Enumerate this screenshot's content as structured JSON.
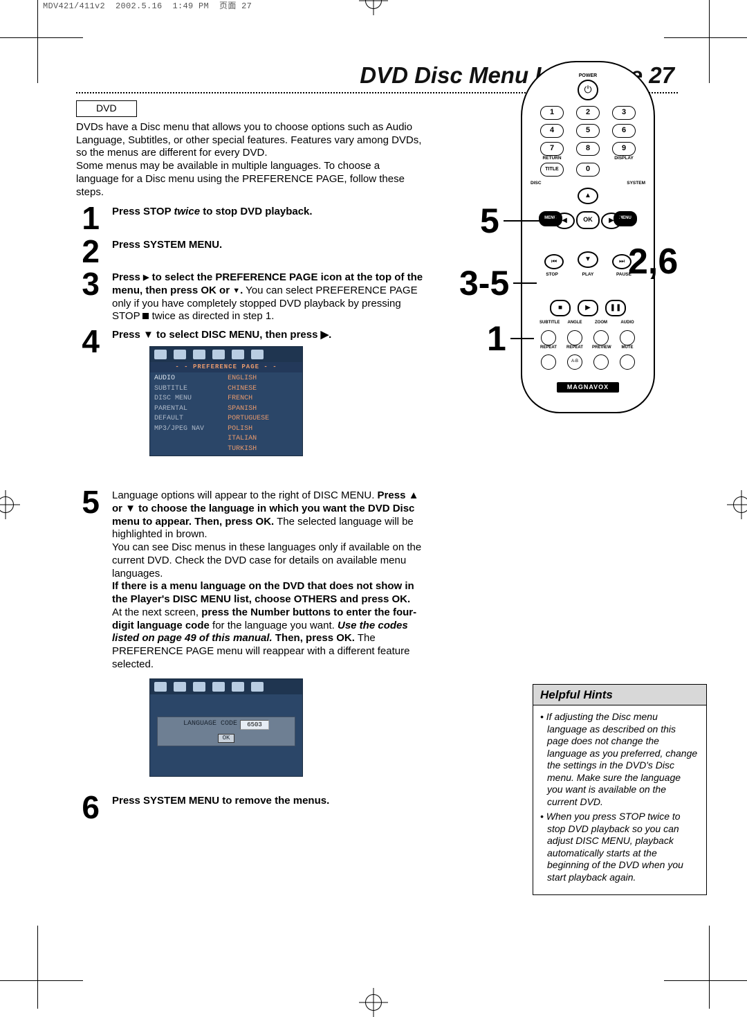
{
  "slug": "MDV421/411v2  2002.5.16  1:49 PM  页面 27",
  "title": "DVD Disc Menu Language  27",
  "dvd_box": "DVD",
  "intro_p1": "DVDs have a Disc menu that allows you to choose options such as Audio Language, Subtitles, or other special features. Features vary among DVDs, so the menus are different for every DVD.",
  "intro_p2": "Some menus may be available in multiple languages. To choose a language for a Disc menu using the PREFERENCE PAGE, follow these steps.",
  "steps": {
    "s1_bold": "Press STOP ",
    "s1_ital": "twice",
    "s1_rest": " to stop DVD playback.",
    "s2": "Press SYSTEM MENU.",
    "s3_b1": "Press ",
    "s3_b2": " to select the PREFERENCE PAGE icon at the top of the menu, then press OK or ",
    "s3_rest": " You can select PREFERENCE PAGE only if you have completely stopped DVD playback by pressing STOP ",
    "s3_end": " twice as directed in step 1.",
    "s4": "Press ▼ to select DISC MENU, then press ▶.",
    "s5_a": "Language options will appear to the right of DISC MENU. ",
    "s5_b": "Press ▲ or ▼ to choose the language in which you want the DVD Disc menu to appear. Then, press OK.",
    "s5_c": " The selected language will be highlighted in brown.",
    "s5_d": "You can see Disc menus in these languages only if available on the current DVD. Check the DVD case for details on available menu languages.",
    "s5_e": "If there is a menu language on the DVD that does not show in the Player's DISC MENU list, choose OTHERS and press OK.",
    "s5_f": "At the next screen, ",
    "s5_g": "press the Number buttons to enter the four-digit language code",
    "s5_h": " for the language you want. ",
    "s5_i": "Use the codes listed on page 49 of this manual.",
    "s5_j": " Then, press OK.",
    "s5_k": " The PREFERENCE PAGE menu will reappear with a different feature selected.",
    "s6": "Press SYSTEM MENU to remove the menus."
  },
  "pref": {
    "header": "- -  PREFERENCE  PAGE  - -",
    "left": [
      "AUDIO",
      "SUBTITLE",
      "DISC MENU",
      "PARENTAL",
      "DEFAULT",
      "MP3/JPEG NAV"
    ],
    "right": [
      "ENGLISH",
      "CHINESE",
      "FRENCH",
      "SPANISH",
      "PORTUGUESE",
      "POLISH",
      "ITALIAN",
      "TURKISH"
    ]
  },
  "lang": {
    "label": "LANGUAGE CODE",
    "value": "6503",
    "ok": "OK"
  },
  "remote": {
    "power": "POWER",
    "nums": [
      "1",
      "2",
      "3",
      "4",
      "5",
      "6",
      "7",
      "8",
      "9"
    ],
    "return": "RETURN",
    "display": "DISPLAY",
    "title": "TITLE",
    "zero": "0",
    "disc": "DISC",
    "system": "SYSTEM",
    "menu": "MENU",
    "ok": "OK",
    "stop": "STOP",
    "play": "PLAY",
    "pause": "PAUSE",
    "row_a": [
      "SUBTITLE",
      "ANGLE",
      "ZOOM",
      "AUDIO"
    ],
    "row_b": [
      "REPEAT",
      "REPEAT",
      "PREVIEW",
      "MUTE"
    ],
    "ab": "A-B",
    "brand": "MAGNAVOX"
  },
  "callouts": {
    "c5": "5",
    "c26": "2,6",
    "c35": "3-5",
    "c1": "1"
  },
  "hints": {
    "header": "Helpful Hints",
    "b1": "If adjusting the Disc menu language as described on this page does not change the language as you preferred, change the settings in the DVD's Disc menu. Make sure the language you want is available on the current DVD.",
    "b2": "When you press STOP twice to stop DVD playback so you can adjust DISC MENU, playback automatically starts at the beginning of the DVD when you start playback again."
  }
}
